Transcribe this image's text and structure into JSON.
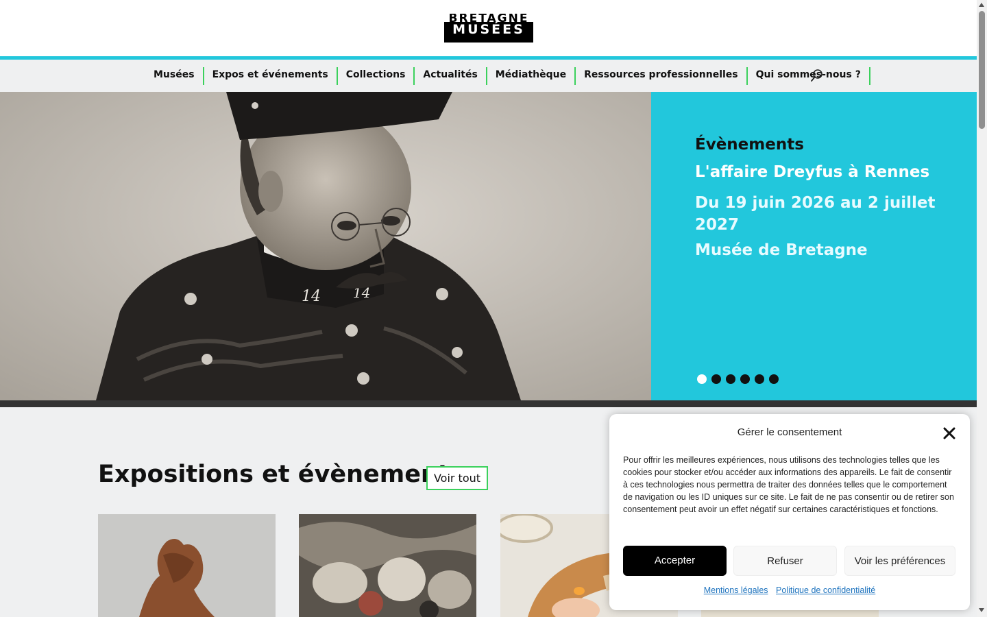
{
  "header": {
    "logo": {
      "line1": "BRETAGNE",
      "line2": "MUSÉES"
    },
    "nav": [
      "Musées",
      "Expos et événements",
      "Collections",
      "Actualités",
      "Médiathèque",
      "Ressources professionnelles",
      "Qui sommes-nous ?"
    ],
    "search_icon": "search-icon",
    "colors": {
      "accent": "#22c7dc",
      "nav_separator": "#3bd15c"
    }
  },
  "hero": {
    "image": "portrait of Alfred Dreyfus in uniform",
    "category": "Évènements",
    "title": "L'affaire Dreyfus à Rennes",
    "dates": "Du 19 juin 2026 au 2 juillet 2027",
    "place": "Musée de Bretagne",
    "slides_count": 6,
    "active_slide": 1
  },
  "section": {
    "title": "Expositions et évènements",
    "see_all": "Voir tout"
  },
  "consent": {
    "title": "Gérer le consentement",
    "body": "Pour offrir les meilleures expériences, nous utilisons des technologies telles que les cookies pour stocker et/ou accéder aux informations des appareils. Le fait de consentir à ces technologies nous permettra de traiter des données telles que le comportement de navigation ou les ID uniques sur ce site. Le fait de ne pas consentir ou de retirer son consentement peut avoir un effet négatif sur certaines caractéristiques et fonctions.",
    "accept": "Accepter",
    "refuse": "Refuser",
    "preferences": "Voir les préférences",
    "legal_link": "Mentions légales",
    "privacy_link": "Politique de confidentialité"
  }
}
